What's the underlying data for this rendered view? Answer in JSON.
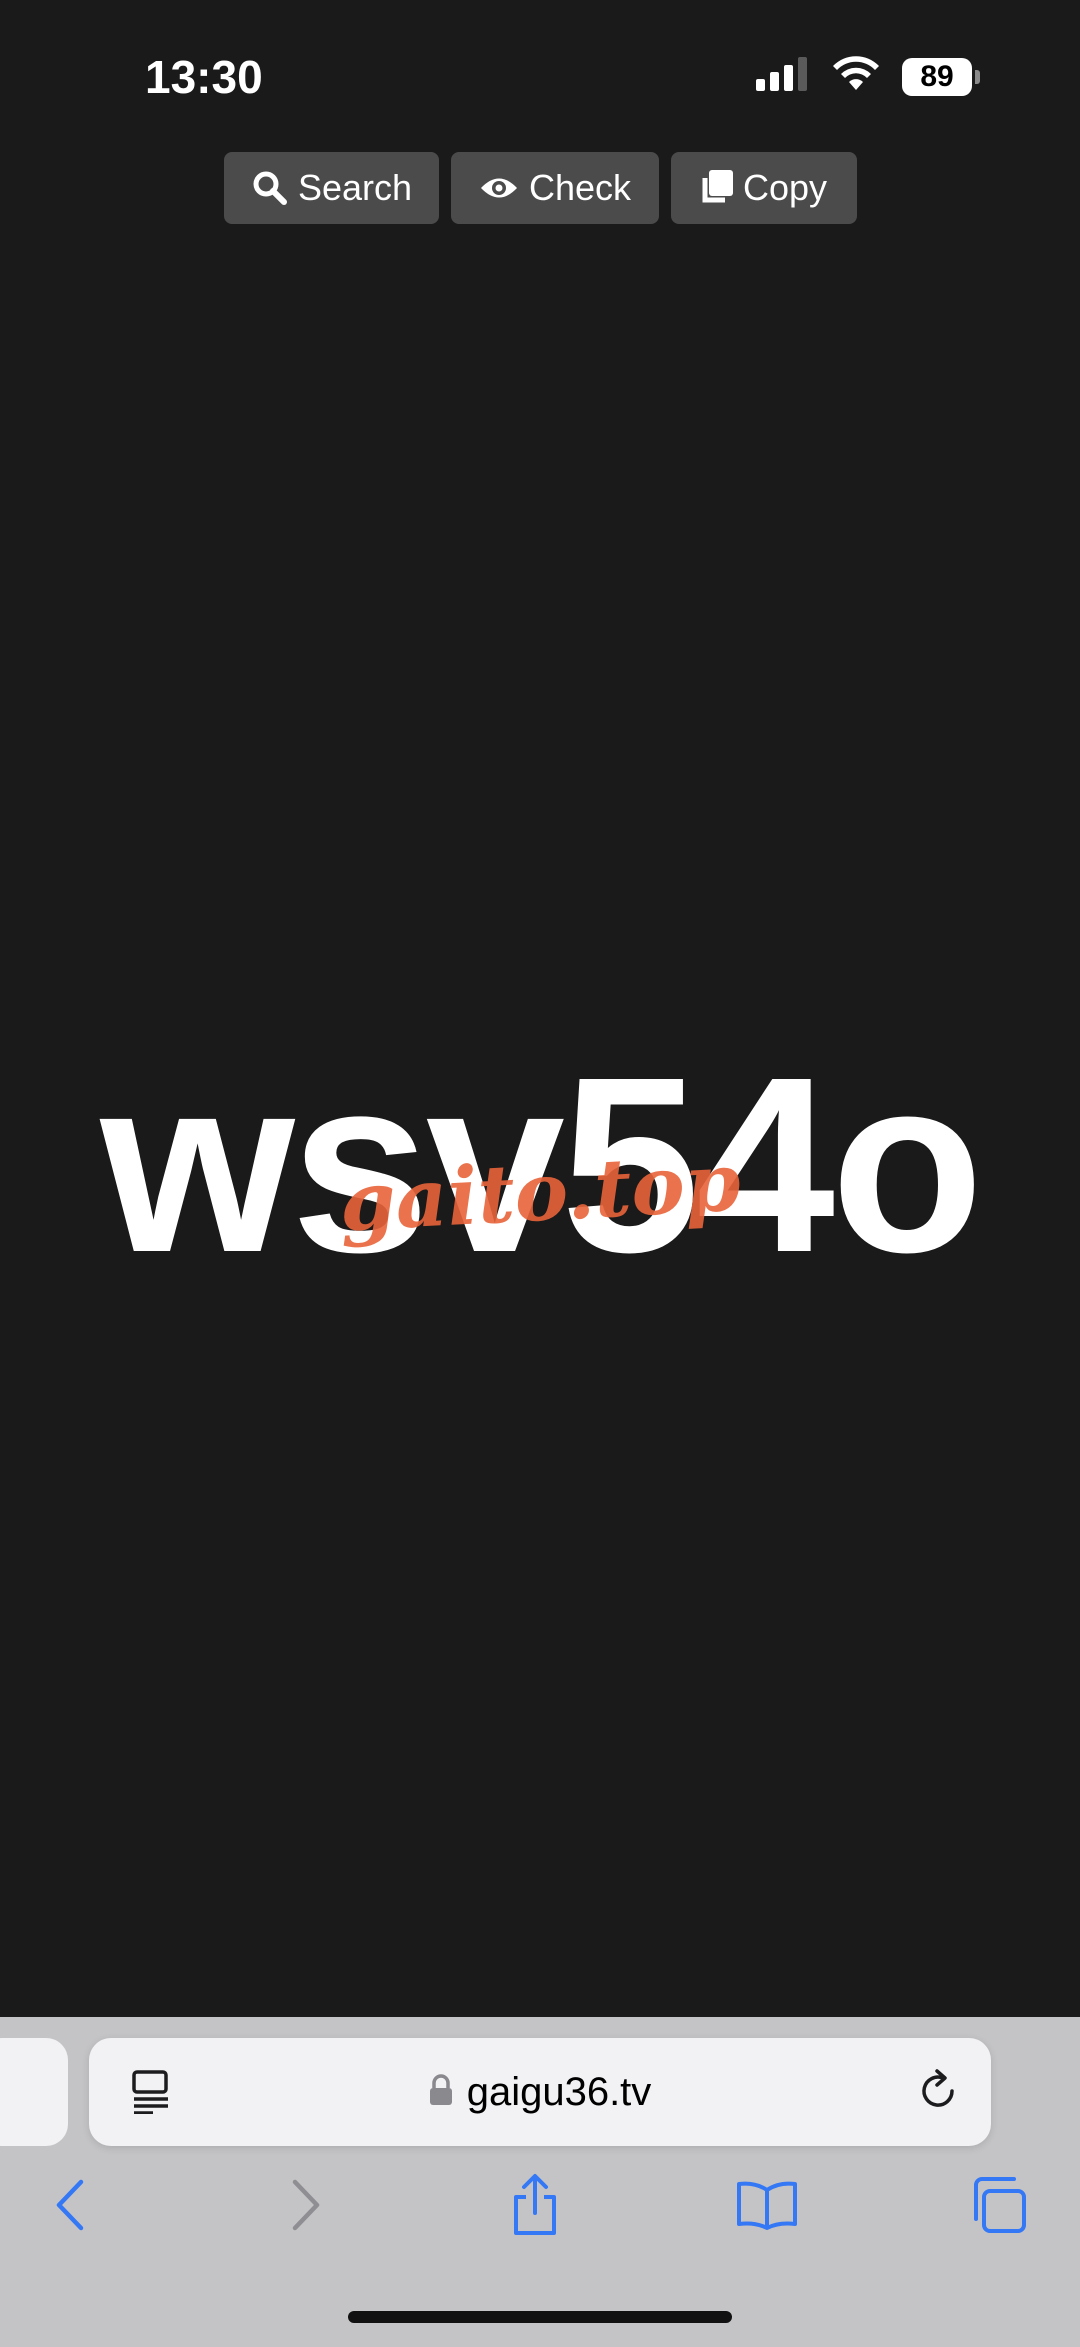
{
  "status_bar": {
    "time": "13:30",
    "battery": "89"
  },
  "toolbar": {
    "search_label": "Search",
    "check_label": "Check",
    "copy_label": "Copy"
  },
  "content": {
    "code": "wsv54o",
    "watermark": "gaito.top"
  },
  "browser": {
    "url": "gaigu36.tv"
  },
  "icons": {
    "search": "search-icon",
    "check": "eye-icon",
    "copy": "copy-icon",
    "reader": "reader-mode-icon",
    "lock": "lock-icon",
    "reload": "reload-icon",
    "back": "chevron-left-icon",
    "forward": "chevron-right-icon",
    "share": "share-icon",
    "bookmarks": "book-icon",
    "tabs": "tabs-icon"
  },
  "colors": {
    "background": "#1a1a1b",
    "button_bg": "#4b4b4c",
    "watermark": "#e8643a",
    "accent": "#3478f6",
    "toolbar_bg": "#c4c4c6"
  }
}
